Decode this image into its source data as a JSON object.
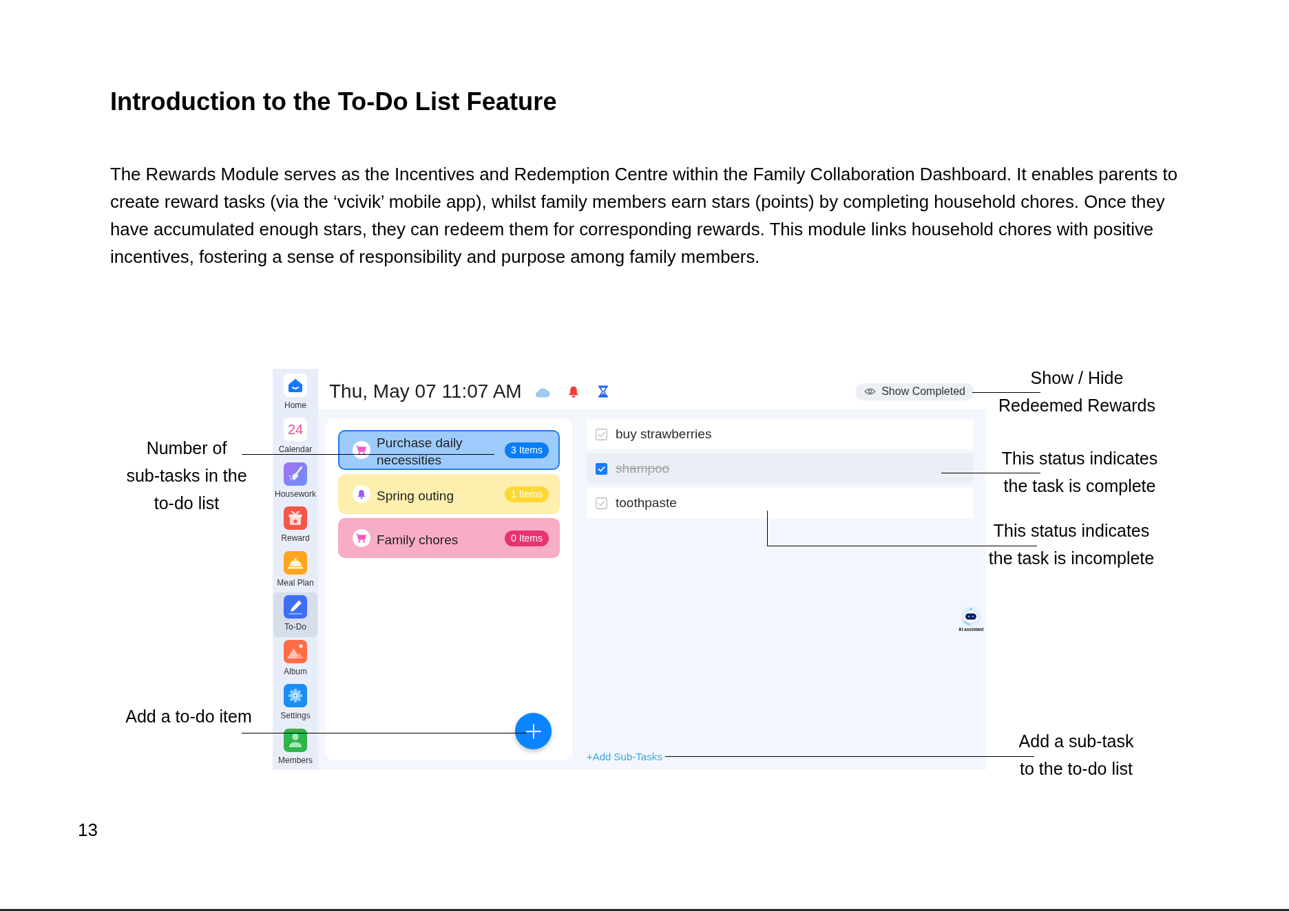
{
  "heading": "Introduction to the To-Do List Feature",
  "intro": "The Rewards Module serves as the Incentives and Redemption Centre within the Family Collaboration Dashboard. It enables parents to create reward tasks (via the ‘vcivik’ mobile app), whilst family members earn stars (points) by completing household chores. Once they have accumulated enough stars, they can redeem them for corresponding rewards. This module links household chores with positive incentives, fostering a sense of responsibility and purpose among family members.",
  "app": {
    "sidebar": [
      {
        "label": "Home",
        "selected": false
      },
      {
        "label": "Calendar",
        "icon_text": "24",
        "selected": false
      },
      {
        "label": "Housework",
        "selected": false
      },
      {
        "label": "Reward",
        "selected": false
      },
      {
        "label": "Meal Plan",
        "selected": false
      },
      {
        "label": "To-Do",
        "selected": true
      },
      {
        "label": "Album",
        "selected": false
      },
      {
        "label": "Settings",
        "selected": false
      },
      {
        "label": "Members",
        "selected": false
      }
    ],
    "header": {
      "datetime": "Thu, May 07 11:07 AM",
      "show_completed": "Show Completed"
    },
    "todo_lists": [
      {
        "title": "Purchase daily necessities",
        "count": "3 Items",
        "kind": "cart",
        "color": "#0a7cf5",
        "selected": true
      },
      {
        "title": "Spring outing",
        "count": "1 Items",
        "kind": "bell",
        "color": "#fdd835",
        "selected": false
      },
      {
        "title": "Family chores",
        "count": "0 Items",
        "kind": "cart",
        "color": "#e8336f",
        "selected": false
      }
    ],
    "subtasks": [
      {
        "text": "buy strawberries",
        "checked": false
      },
      {
        "text": "shampoo",
        "checked": true
      },
      {
        "text": "toothpaste",
        "checked": false
      }
    ],
    "assistant_label": "AI assistant",
    "add_subtasks": "+Add Sub-Tasks"
  },
  "callouts": [
    {
      "lines": [
        "Number of",
        "sub-tasks in the",
        "to-do list"
      ]
    },
    {
      "lines": [
        "Add a to-do item"
      ]
    },
    {
      "lines": [
        "Show / Hide",
        "Redeemed Rewards"
      ]
    },
    {
      "lines": [
        "This status indicates",
        "the task is complete"
      ]
    },
    {
      "lines": [
        "This status indicates",
        "the task is incomplete"
      ]
    },
    {
      "lines": [
        "Add a sub-task",
        "to the to-do list"
      ]
    }
  ],
  "page_number": "13"
}
